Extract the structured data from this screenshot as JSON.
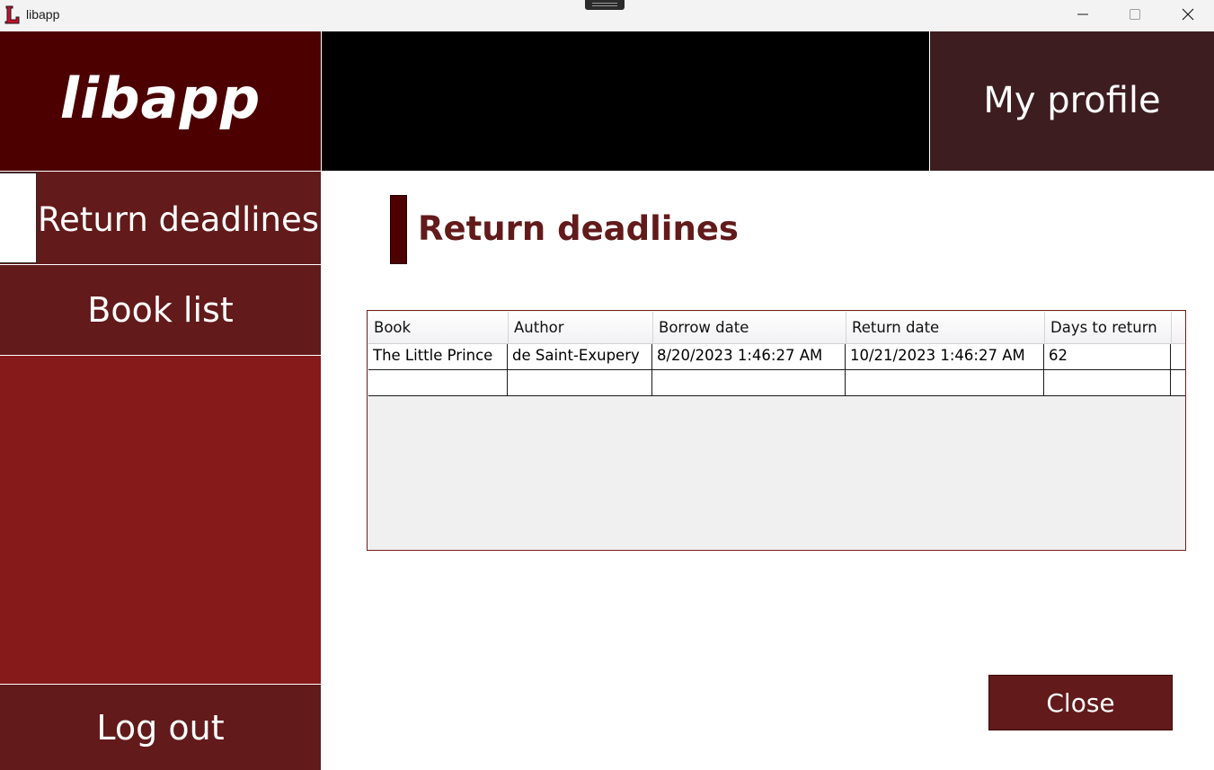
{
  "window": {
    "title": "libapp",
    "icon": "libapp-L-icon",
    "controls": [
      "minimize-icon",
      "maximize-icon",
      "close-icon"
    ]
  },
  "header": {
    "logo": "libapp",
    "profile_label": "My profile"
  },
  "sidebar": {
    "active_item": "Return deadlines",
    "items": [
      {
        "label": "Return deadlines"
      },
      {
        "label": "Book list"
      }
    ],
    "logout_label": "Log out"
  },
  "main": {
    "heading": "Return deadlines",
    "table": {
      "columns": [
        "Book",
        "Author",
        "Borrow date",
        "Return date",
        "Days to return"
      ],
      "rows": [
        [
          "The Little Prince",
          "de Saint-Exupery",
          "8/20/2023 1:46:27 AM",
          "10/21/2023 1:46:27 AM",
          "62"
        ],
        [
          "",
          "",
          "",
          "",
          ""
        ]
      ]
    },
    "close_label": "Close"
  },
  "colors": {
    "logo_bg": "#4d0000",
    "header_black": "#000000",
    "profile_bg": "#3d1d20",
    "sidebar_item_bg": "#621a1b",
    "sidebar_fill": "#861919",
    "heading_color": "#621a1b",
    "button_bg": "#621a1b"
  }
}
